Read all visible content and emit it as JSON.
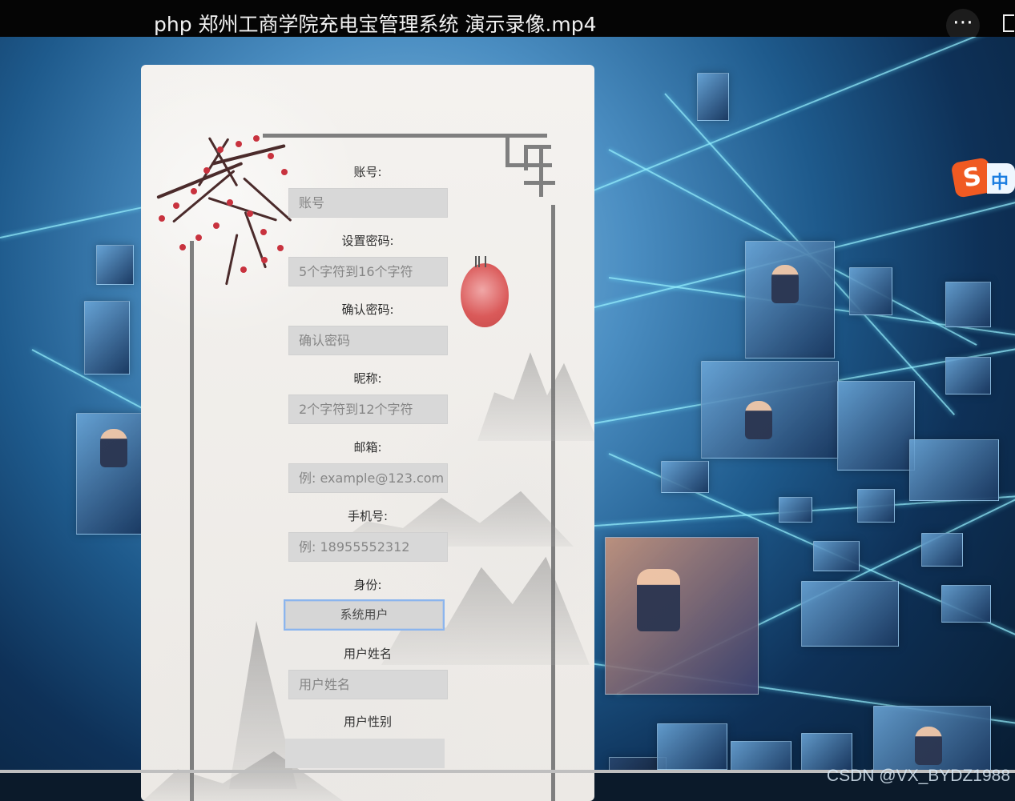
{
  "video": {
    "title": "php 郑州工商学院充电宝管理系统 演示录像.mp4",
    "more_icon": "ellipsis-icon"
  },
  "ime": {
    "badge": "S",
    "mode": "中"
  },
  "form": {
    "fields": [
      {
        "label": "账号:",
        "placeholder": "账号"
      },
      {
        "label": "设置密码:",
        "placeholder": "5个字符到16个字符"
      },
      {
        "label": "确认密码:",
        "placeholder": "确认密码"
      },
      {
        "label": "昵称:",
        "placeholder": "2个字符到12个字符"
      },
      {
        "label": "邮箱:",
        "placeholder": "例: example@123.com"
      },
      {
        "label": "手机号:",
        "placeholder": "例: 18955552312"
      },
      {
        "label": "身份:",
        "selected": "系统用户"
      },
      {
        "label": "用户姓名",
        "placeholder": "用户姓名"
      },
      {
        "label": "用户性别",
        "value": ""
      }
    ]
  },
  "watermark": "CSDN @VX_BYDZ1988"
}
